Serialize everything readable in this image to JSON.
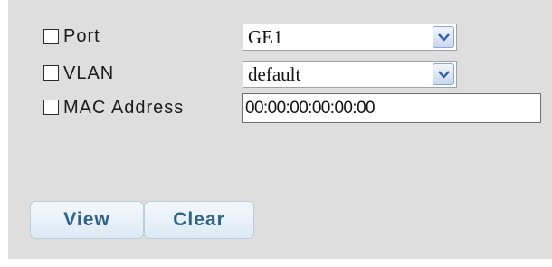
{
  "filters": {
    "port": {
      "label": "Port",
      "checked": false,
      "selected": "GE1"
    },
    "vlan": {
      "label": "VLAN",
      "checked": false,
      "selected": "default"
    },
    "mac": {
      "label": "MAC Address",
      "checked": false,
      "value": "00:00:00:00:00:00"
    }
  },
  "buttons": {
    "view": "View",
    "clear": "Clear"
  },
  "icons": {
    "dropdown": "chevron-down-icon"
  },
  "colors": {
    "panel": "#dedede",
    "button_text": "#2d6289",
    "dropdown_arrow": "#2f5da8"
  }
}
